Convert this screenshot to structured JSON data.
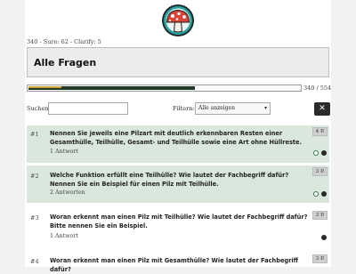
{
  "stats": "340 - Sure: 62 - Clarify: 5",
  "page_title": "Alle Fragen",
  "progress": {
    "label": "340 / 554",
    "fraction": 0.614,
    "secondary_fraction": 0.12
  },
  "search": {
    "label": "Suchen:",
    "value": ""
  },
  "filter": {
    "label": "Filtern:",
    "selected": "Alle anzeigen"
  },
  "clear_icon": "close-icon",
  "questions": [
    {
      "num": "#1",
      "text": "Nennen Sie jeweils eine Pilzart mit deutlich erkennbaren Resten einer Gesamthülle, Teilhülle, Gesamt- und Teilhülle sowie eine Art ohne Hüllreste.",
      "answers": "1 Antwort",
      "points": "4 P."
    },
    {
      "num": "#2",
      "text": "Welche Funktion erfüllt eine Teilhülle? Wie lautet der Fachbegriff dafür? Nennen Sie ein Beispiel für einen Pilz mit Teilhülle.",
      "answers": "2 Antworten",
      "points": "3 P."
    },
    {
      "num": "#3",
      "text": "Woran erkennt man einen Pilz mit Teilhülle? Wie lautet der Fachbegriff dafür? Bitte nennen Sie ein Beispiel.",
      "answers": "1 Antwort",
      "points": "3 P."
    },
    {
      "num": "#4",
      "text": "Woran erkennt man einen Pilz mit Gesamthülle? Wie lautet der Fachbegriff dafür?",
      "answers": "",
      "points": "3 P."
    }
  ],
  "colors": {
    "accent_green_bg": "#d9e7dd",
    "progress_fill": "#1f3a26",
    "progress_secondary": "#cfa33a",
    "mushroom_cap": "#d8443a",
    "logo_ring": "#2aa3a0"
  }
}
